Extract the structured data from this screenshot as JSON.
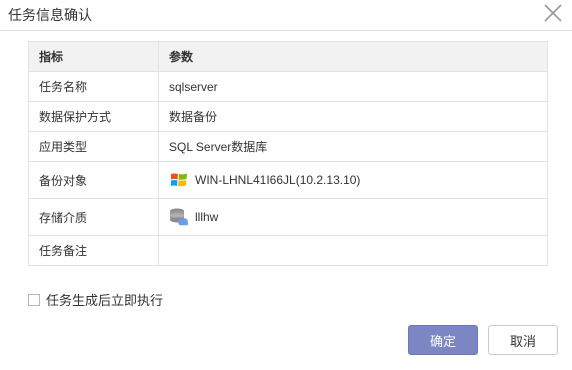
{
  "dialog": {
    "title": "任务信息确认",
    "close_icon": "close-icon"
  },
  "table": {
    "headers": [
      "指标",
      "参数"
    ],
    "rows": [
      {
        "label": "任务名称",
        "value": "sqlserver"
      },
      {
        "label": "数据保护方式",
        "value": "数据备份"
      },
      {
        "label": "应用类型",
        "value": "SQL Server数据库"
      },
      {
        "label": "备份对象",
        "value": "WIN-LHNL41I66JL(10.2.13.10)",
        "icon": "windows-logo-icon"
      },
      {
        "label": "存储介质",
        "value": "lllhw",
        "icon": "cloud-storage-icon"
      },
      {
        "label": "任务备注",
        "value": ""
      }
    ]
  },
  "options": {
    "execute_now_label": "任务生成后立即执行",
    "execute_now_checked": false
  },
  "buttons": {
    "ok_label": "确定",
    "cancel_label": "取消"
  },
  "colors": {
    "primary_button": "#7b86c2",
    "header_bg": "#f2f2f2",
    "border": "#e2e2e2"
  }
}
